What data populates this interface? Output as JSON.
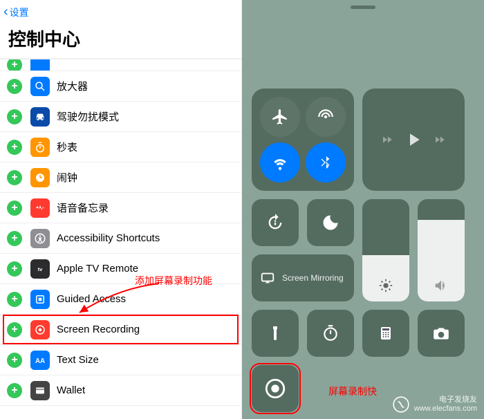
{
  "navBack": "设置",
  "title": "控制中心",
  "rows": [
    {
      "label": "放大器",
      "iconType": "magnifier",
      "iconBg": "ic-blue"
    },
    {
      "label": "驾驶勿扰模式",
      "iconType": "car",
      "iconBg": "ic-darkblue"
    },
    {
      "label": "秒表",
      "iconType": "stopwatch",
      "iconBg": "ic-orange"
    },
    {
      "label": "闹钟",
      "iconType": "clock",
      "iconBg": "ic-orange"
    },
    {
      "label": "语音备忘录",
      "iconType": "voice",
      "iconBg": "ic-red"
    },
    {
      "label": "Accessibility Shortcuts",
      "iconType": "access",
      "iconBg": "ic-darkgray"
    },
    {
      "label": "Apple TV Remote",
      "iconType": "tv",
      "iconBg": "ic-black"
    },
    {
      "label": "Guided Access",
      "iconType": "guided",
      "iconBg": "ic-blue"
    },
    {
      "label": "Screen Recording",
      "iconType": "record",
      "iconBg": "ic-red",
      "highlighted": true
    },
    {
      "label": "Text Size",
      "iconType": "textsize",
      "iconBg": "ic-aa"
    },
    {
      "label": "Wallet",
      "iconType": "wallet",
      "iconBg": "ic-wallet"
    }
  ],
  "annotation1": "添加屏幕录制功能",
  "annotation2": "屏幕录制快",
  "controlCenter": {
    "screenMirroring": "Screen Mirroring",
    "brightnessFill": 45,
    "volumeFill": 80
  },
  "watermark": {
    "line1": "电子发烧友",
    "line2": "www.elecfans.com"
  }
}
